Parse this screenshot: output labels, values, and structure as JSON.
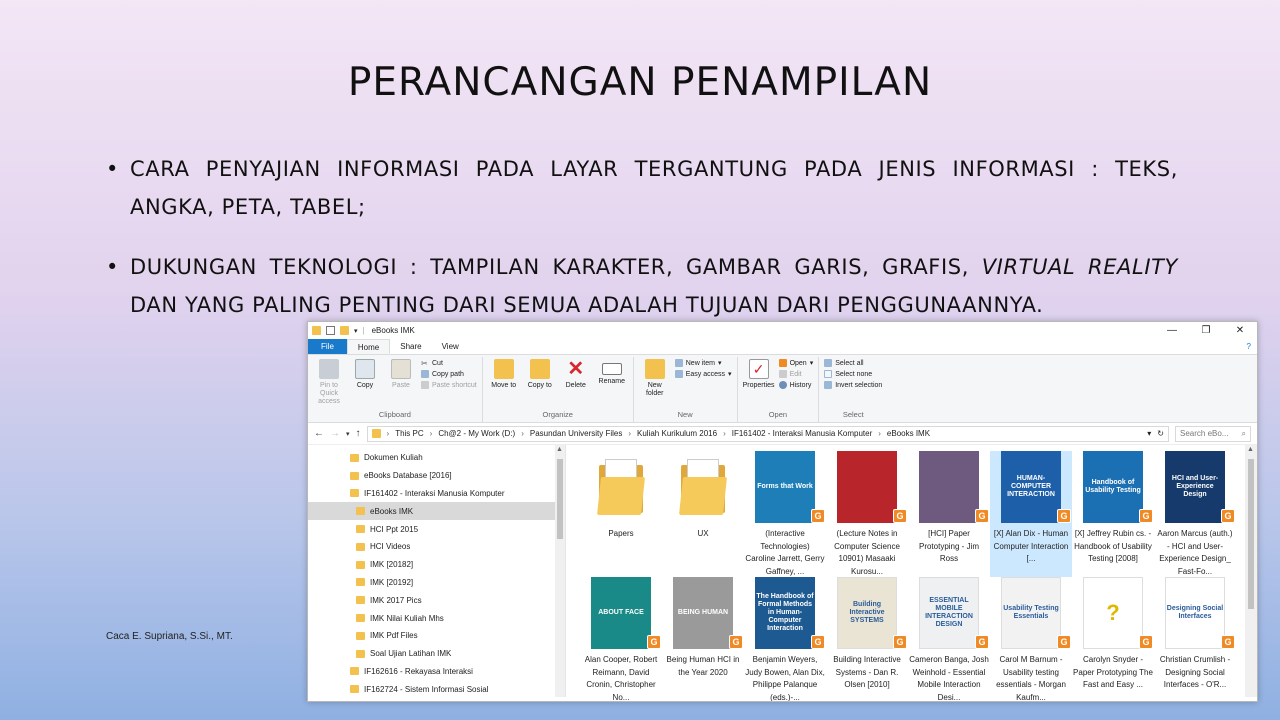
{
  "slide": {
    "title": "PERANCANGAN PENAMPILAN",
    "bullet1": "CARA PENYAJIAN INFORMASI PADA LAYAR TERGANTUNG PADA JENIS INFORMASI : TEKS, ANGKA, PETA, TABEL;",
    "bullet2_a": "DUKUNGAN TEKNOLOGI : TAMPILAN KARAKTER, GAMBAR GARIS, GRAFIS, ",
    "bullet2_italic": "VIRTUAL REALITY",
    "bullet2_b": " DAN YANG PALING PENTING DARI SEMUA ADALAH TUJUAN DARI PENGGUNAANNYA.",
    "credit": "Caca E. Supriana, S.Si., MT."
  },
  "window": {
    "title": "eBooks IMK",
    "tabs": {
      "file": "File",
      "home": "Home",
      "share": "Share",
      "view": "View",
      "help": "?"
    },
    "ribbon": {
      "clipboard": {
        "pin": "Pin to Quick access",
        "copy": "Copy",
        "paste": "Paste",
        "cut": "Cut",
        "copy_path": "Copy path",
        "paste_shortcut": "Paste shortcut",
        "name": "Clipboard"
      },
      "organize": {
        "move_to": "Move to",
        "copy_to": "Copy to",
        "delete": "Delete",
        "rename": "Rename",
        "name": "Organize"
      },
      "new": {
        "new_folder": "New folder",
        "new_item": "New item",
        "easy_access": "Easy access",
        "name": "New"
      },
      "open": {
        "properties": "Properties",
        "open": "Open",
        "edit": "Edit",
        "history": "History",
        "name": "Open"
      },
      "select": {
        "select_all": "Select all",
        "select_none": "Select none",
        "invert": "Invert selection",
        "name": "Select"
      }
    },
    "path": [
      "This PC",
      "Ch@2 - My Work (D:)",
      "Pasundan University Files",
      "Kuliah Kurikulum 2016",
      "IF161402 - Interaksi Manusia Komputer",
      "eBooks IMK"
    ],
    "search_placeholder": "Search eBo...",
    "tree": [
      {
        "label": "Dokumen Kuliah"
      },
      {
        "label": "eBooks Database [2016]"
      },
      {
        "label": "IF161402 - Interaksi Manusia Komputer"
      },
      {
        "label": "eBooks IMK"
      },
      {
        "label": "HCI Ppt 2015"
      },
      {
        "label": "HCI Videos"
      },
      {
        "label": "IMK [20182]"
      },
      {
        "label": "IMK [20192]"
      },
      {
        "label": "IMK 2017 Pics"
      },
      {
        "label": "IMK Nilai Kuliah Mhs"
      },
      {
        "label": "IMK Pdf Files"
      },
      {
        "label": "Soal Ujian Latihan IMK"
      },
      {
        "label": "IF162616 - Rekayasa Interaksi"
      },
      {
        "label": "IF162724 - Sistem Informasi Sosial"
      }
    ],
    "files": [
      {
        "label": "Papers",
        "cover_text": "",
        "color": "#f5c95a"
      },
      {
        "label": "UX",
        "cover_text": "",
        "color": "#f5c95a"
      },
      {
        "label": "(Interactive Technologies) Caroline Jarrett, Gerry Gaffney, ...",
        "cover_text": "Forms that Work",
        "color": "#1e7fb8"
      },
      {
        "label": "(Lecture Notes in Computer Science 10901) Masaaki Kurosu...",
        "cover_text": "",
        "color": "#b8252a"
      },
      {
        "label": "[HCI] Paper Prototyping - Jim Ross",
        "cover_text": "",
        "color": "#6d5a7e"
      },
      {
        "label": "[X] Alan Dix - Human Computer Interaction [...",
        "cover_text": "HUMAN-COMPUTER INTERACTION",
        "color": "#1d5fa8"
      },
      {
        "label": "[X] Jeffrey Rubin cs. - Handbook of Usability Testing [2008]",
        "cover_text": "Handbook of Usability Testing",
        "color": "#1b6fb3"
      },
      {
        "label": "Aaron Marcus (auth.) - HCI and User-Experience Design_ Fast-Fo...",
        "cover_text": "HCI and User-Experience Design",
        "color": "#153a6b"
      },
      {
        "label": "Alan Cooper, Robert Reimann, David Cronin, Christopher No...",
        "cover_text": "ABOUT FACE",
        "color": "#1a8a88"
      },
      {
        "label": "Being Human HCI in the Year 2020",
        "cover_text": "BEING HUMAN",
        "color": "#9a9a9a"
      },
      {
        "label": "Benjamin Weyers, Judy Bowen, Alan Dix, Philippe Palanque (eds.)-...",
        "cover_text": "The Handbook of Formal Methods in Human-Computer Interaction",
        "color": "#1e5a92"
      },
      {
        "label": "Building Interactive Systems - Dan R. Olsen [2010]",
        "cover_text": "Building Interactive SYSTEMS",
        "color": "#e9e4d4"
      },
      {
        "label": "Cameron Banga, Josh Weinhold - Essential Mobile Interaction Desi...",
        "cover_text": "ESSENTIAL MOBILE INTERACTION DESIGN",
        "color": "#eef0f2"
      },
      {
        "label": "Carol M Barnum - Usability testing essentials - Morgan Kaufm...",
        "cover_text": "Usability Testing Essentials",
        "color": "#f2f2f2"
      },
      {
        "label": "Carolyn Snyder - Paper Prototyping The Fast and Easy ...",
        "cover_text": "?",
        "color": "#ffffff"
      },
      {
        "label": "Christian Crumlish - Designing Social Interfaces - O'R...",
        "cover_text": "Designing Social Interfaces",
        "color": "#ffffff"
      }
    ],
    "selected_file_index": 5,
    "selected_tree_index": 3
  }
}
